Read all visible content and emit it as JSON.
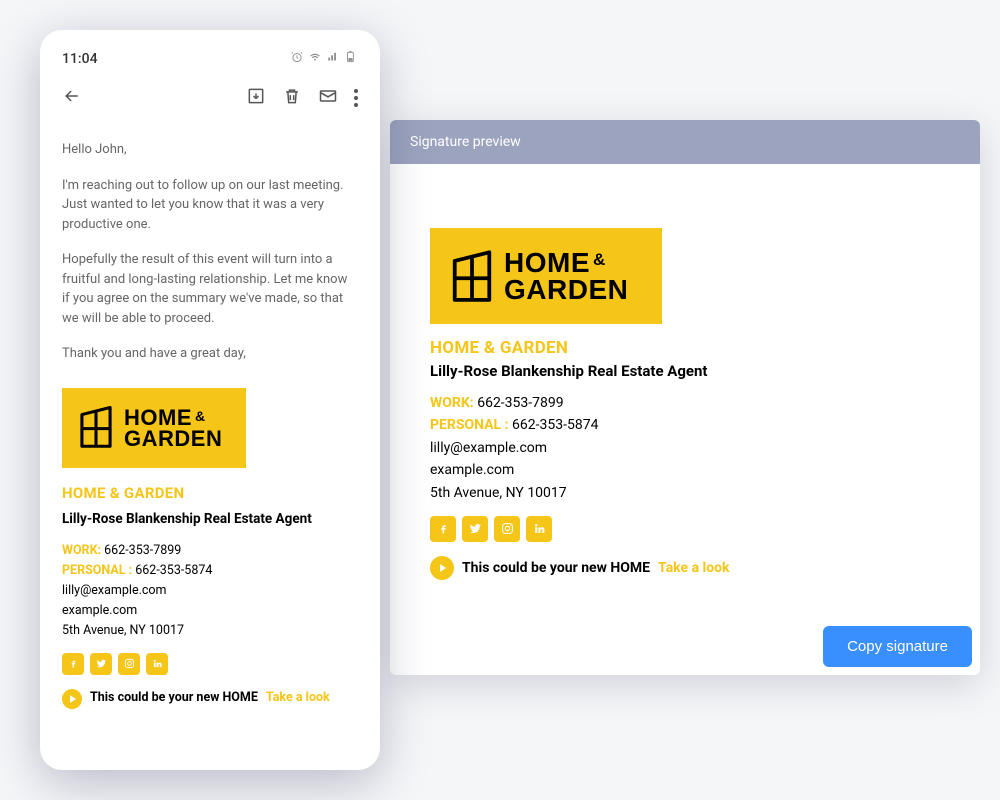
{
  "phone": {
    "time": "11:04",
    "email": {
      "greeting": "Hello John,",
      "para1": "I'm reaching out to follow up on our last meeting. Just wanted to let you know that it was a very productive one.",
      "para2": "Hopefully the result of this event will turn into a fruitful and long-lasting relationship. Let me know if you agree on the summary we've made, so that we will be able to proceed.",
      "para3": "Thank you and have a great day,"
    }
  },
  "preview": {
    "header": "Signature preview",
    "copy_button": "Copy signature"
  },
  "signature": {
    "logo_line1": "HOME",
    "logo_amp": "&",
    "logo_line2": "GARDEN",
    "company": "HOME & GARDEN",
    "name": "Lilly-Rose Blankenship Real Estate Agent",
    "work_label": "WORK:",
    "work_phone": "662-353-7899",
    "personal_label": "PERSONAL :",
    "personal_phone": "662-353-5874",
    "email": "lilly@example.com",
    "website": "example.com",
    "address": "5th Avenue, NY 10017",
    "cta_text": "This could be your new HOME",
    "cta_link": "Take a look"
  }
}
